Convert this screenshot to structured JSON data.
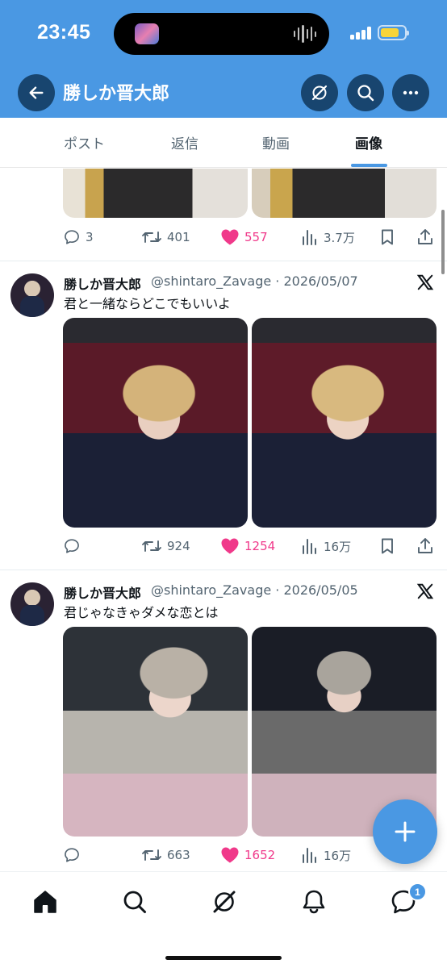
{
  "status_bar": {
    "time": "23:45",
    "battery_color": "#f7d43a"
  },
  "header": {
    "title": "勝しか晋大郎"
  },
  "tabs": [
    {
      "label": "ポスト",
      "active": false
    },
    {
      "label": "返信",
      "active": false
    },
    {
      "label": "動画",
      "active": false
    },
    {
      "label": "画像",
      "active": true
    }
  ],
  "posts": [
    {
      "partial": true,
      "stats": {
        "replies": "3",
        "reposts": "401",
        "likes": "557",
        "views": "3.7万"
      }
    },
    {
      "name": "勝しか晋大郎",
      "handle": "@shintaro_Zavage · 2026/05/07",
      "text": "君と一緒ならどこでもいいよ",
      "stats": {
        "replies": "",
        "reposts": "924",
        "likes": "1254",
        "views": "16万"
      }
    },
    {
      "name": "勝しか晋大郎",
      "handle": "@shintaro_Zavage · 2026/05/05",
      "text": "君じゃなきゃダメな恋とは",
      "stats": {
        "replies": "",
        "reposts": "663",
        "likes": "1652",
        "views": "16万"
      }
    }
  ],
  "bottom_nav": {
    "items": [
      "home-icon",
      "search-icon",
      "grok-icon",
      "notifications-icon",
      "messages-icon"
    ],
    "messages_badge": "1"
  },
  "colors": {
    "accent": "#4a98e3",
    "header_dark_button": "#18456f",
    "like": "#f0398a",
    "muted": "#536471"
  }
}
